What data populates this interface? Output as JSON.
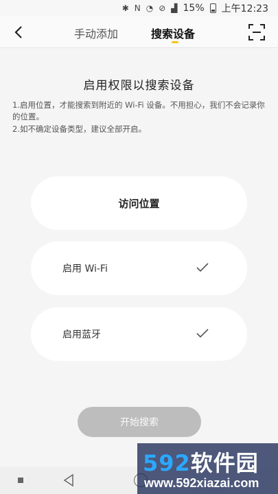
{
  "status_bar": {
    "battery": "15%",
    "time": "上午12:23"
  },
  "header": {
    "tab_manual": "手动添加",
    "tab_search": "搜索设备"
  },
  "content": {
    "title": "启用权限以搜索设备",
    "desc1": "1.启用位置，才能搜索到附近的 Wi-Fi 设备。不用担心，我们不会记录你的位置。",
    "desc2": "2.如不确定设备类型，建议全部开启。"
  },
  "cards": {
    "location": "访问位置",
    "wifi": "启用 Wi-Fi",
    "bluetooth": "启用蓝牙"
  },
  "actions": {
    "start_search": "开始搜索"
  },
  "watermark": {
    "logo_a": "592",
    "logo_b": "软件园",
    "url": "www.592xiazai.com"
  },
  "colors": {
    "accent": "#f5c518",
    "disabled_button": "#bdbdbd"
  }
}
